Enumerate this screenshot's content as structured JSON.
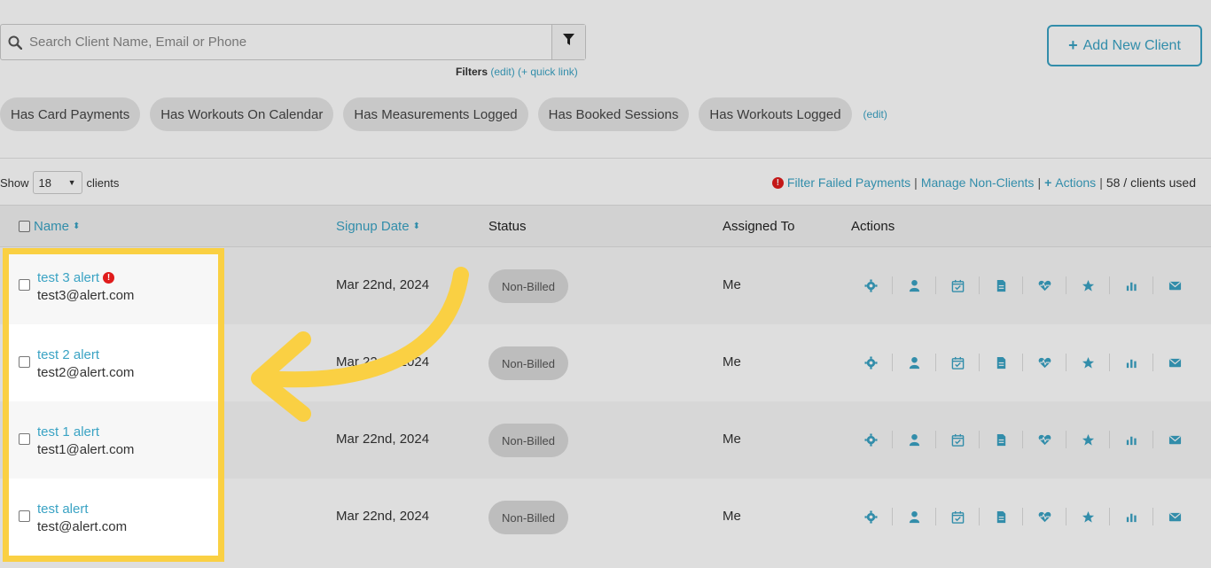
{
  "search": {
    "placeholder": "Search Client Name, Email or Phone",
    "filters_label": "Filters",
    "filters_edit": "(edit)",
    "filters_quick_link": "(+ quick link)"
  },
  "add_client": {
    "label": "Add New Client"
  },
  "chips": [
    "Has Card Payments",
    "Has Workouts On Calendar",
    "Has Measurements Logged",
    "Has Booked Sessions",
    "Has Workouts Logged"
  ],
  "chips_edit": "(edit)",
  "show": {
    "label": "Show",
    "value": "18",
    "suffix": "clients"
  },
  "links": {
    "failed_payments": "Filter Failed Payments",
    "manage_non_clients": "Manage Non-Clients",
    "actions": "Actions",
    "clients_used": "58 / clients used"
  },
  "table": {
    "headers": {
      "name": "Name",
      "signup_date": "Signup Date",
      "status": "Status",
      "assigned_to": "Assigned To",
      "actions": "Actions"
    },
    "rows": [
      {
        "name": "test 3 alert",
        "email": "test3@alert.com",
        "date": "Mar 22nd, 2024",
        "status": "Non-Billed",
        "assigned": "Me",
        "alert": true
      },
      {
        "name": "test 2 alert",
        "email": "test2@alert.com",
        "date": "Mar 22nd, 2024",
        "status": "Non-Billed",
        "assigned": "Me",
        "alert": false
      },
      {
        "name": "test 1 alert",
        "email": "test1@alert.com",
        "date": "Mar 22nd, 2024",
        "status": "Non-Billed",
        "assigned": "Me",
        "alert": false
      },
      {
        "name": "test alert",
        "email": "test@alert.com",
        "date": "Mar 22nd, 2024",
        "status": "Non-Billed",
        "assigned": "Me",
        "alert": false
      }
    ],
    "action_icons": [
      "gear-icon",
      "user-icon",
      "calendar-check-icon",
      "document-icon",
      "heart-pulse-icon",
      "star-icon",
      "bar-chart-icon",
      "envelope-icon"
    ]
  },
  "colors": {
    "accent": "#3aa3c4",
    "highlight": "#fad043",
    "alert": "#e01b1b"
  }
}
